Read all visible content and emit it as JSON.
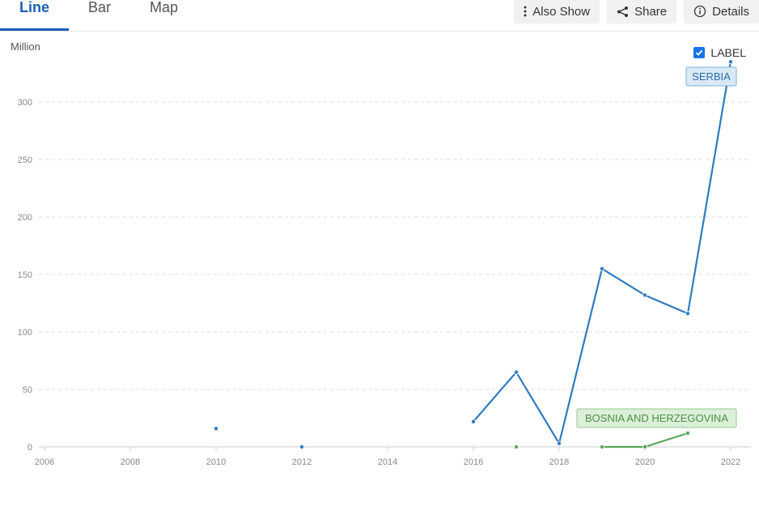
{
  "tabs": [
    {
      "label": "Line",
      "active": true
    },
    {
      "label": "Bar",
      "active": false
    },
    {
      "label": "Map",
      "active": false
    }
  ],
  "toolbar": {
    "also_show": "Also Show",
    "share": "Share",
    "details": "Details"
  },
  "icons": {
    "also_show": "vertical-ellipsis-icon",
    "share": "share-icon",
    "details": "info-circle-icon"
  },
  "unit_label": "Million",
  "label_toggle": {
    "text": "LABEL",
    "checked": true
  },
  "colors": {
    "accent": "#1a5fb4",
    "serbia": "#2e7bbf",
    "bosnia": "#5aa65a"
  },
  "chart_data": {
    "type": "line",
    "x_ticks": [
      2006,
      2008,
      2010,
      2012,
      2014,
      2016,
      2018,
      2020,
      2022
    ],
    "y_ticks": [
      0,
      50,
      100,
      150,
      200,
      250,
      300
    ],
    "xlim": [
      2006,
      2022
    ],
    "ylim": [
      0,
      330
    ],
    "grid": true,
    "series": [
      {
        "name": "SERBIA",
        "color": "#2e7bbf",
        "points": [
          {
            "x": 2010,
            "y": 16
          },
          {
            "x": 2012,
            "y": 0
          },
          {
            "x": 2016,
            "y": 22
          },
          {
            "x": 2017,
            "y": 65
          },
          {
            "x": 2018,
            "y": 3
          },
          {
            "x": 2019,
            "y": 155
          },
          {
            "x": 2020,
            "y": 132
          },
          {
            "x": 2021,
            "y": 116
          },
          {
            "x": 2022,
            "y": 335
          }
        ]
      },
      {
        "name": "BOSNIA AND HERZEGOVINA",
        "color": "#5aa65a",
        "points": [
          {
            "x": 2017,
            "y": 0
          },
          {
            "x": 2019,
            "y": 0
          },
          {
            "x": 2020,
            "y": 0
          },
          {
            "x": 2021,
            "y": 12
          }
        ]
      }
    ]
  }
}
